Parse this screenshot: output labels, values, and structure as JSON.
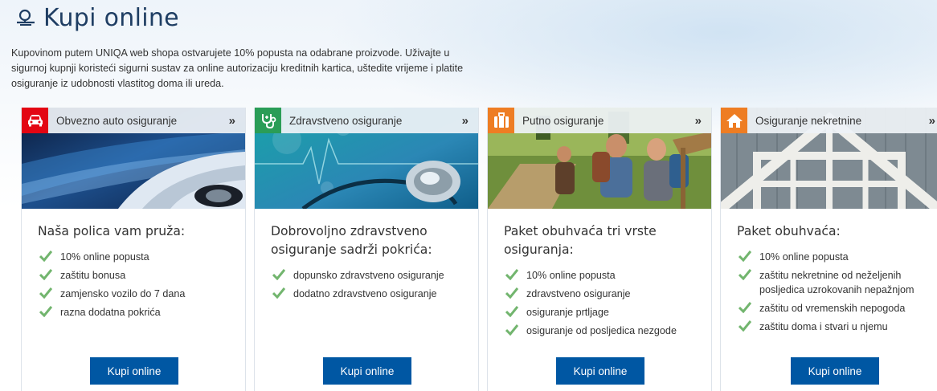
{
  "page": {
    "title": "Kupi online",
    "intro": "Kupovinom putem UNIQA web shopa ostvarujete 10% popusta na odabrane proizvode. Uživajte u sigurnoj kupnji koristeći sigurni sustav za online autorizaciju kreditnih kartica, uštedite vrijeme i platite osiguranje iz udobnosti vlastitog doma ili ureda."
  },
  "colors": {
    "accent_orange": "#ee7d23",
    "accent_red": "#e30613",
    "accent_green": "#2a9d57",
    "button_blue": "#0057a3",
    "check_green": "#72b56e"
  },
  "cards": [
    {
      "header": "Obvezno auto osiguranje",
      "icon": "car-icon",
      "arrow": "»",
      "heading": "Naša polica vam pruža:",
      "items": [
        "10% online popusta",
        "zaštitu bonusa",
        "zamjensko vozilo do 7 dana",
        "razna dodatna pokrića"
      ],
      "button": "Kupi online"
    },
    {
      "header": "Zdravstveno osiguranje",
      "icon": "stethoscope-icon",
      "arrow": "»",
      "heading": "Dobrovoljno zdravstveno osiguranje sadrži pokrića:",
      "items": [
        "dopunsko zdravstveno osiguranje",
        "dodatno zdravstveno osiguranje"
      ],
      "button": "Kupi online"
    },
    {
      "header": "Putno osiguranje",
      "icon": "suitcase-icon",
      "arrow": "»",
      "heading": "Paket obuhvaća tri vrste osiguranja:",
      "items": [
        "10% online popusta",
        "zdravstveno osiguranje",
        "osiguranje prtljage",
        "osiguranje od posljedica nezgode"
      ],
      "button": "Kupi online"
    },
    {
      "header": "Osiguranje nekretnine",
      "icon": "house-icon",
      "arrow": "»",
      "heading": "Paket obuhvaća:",
      "items": [
        "10% online popusta",
        "zaštitu nekretnine od neželjenih posljedica uzrokovanih nepažnjom",
        "zaštitu od vremenskih nepogoda",
        "zaštitu doma i stvari u njemu"
      ],
      "button": "Kupi online"
    }
  ]
}
